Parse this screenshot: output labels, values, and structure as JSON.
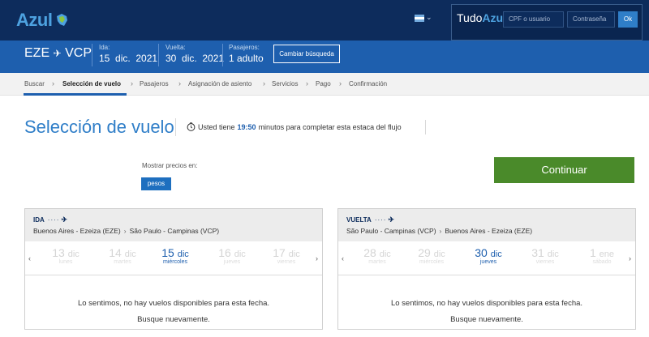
{
  "header": {
    "logo_text": "Azul",
    "tudo_prefix": "Tudo",
    "tudo_brand": "Azul",
    "cpf_placeholder": "CPF o usuario",
    "password_placeholder": "Contraseña",
    "ok_label": "Ok"
  },
  "search": {
    "route_from": "EZE",
    "route_to": "VCP",
    "ida_label": "Ida:",
    "ida_value": "15  dic.  2021",
    "vuelta_label": "Vuelta:",
    "vuelta_value": "30  dic.  2021",
    "pasajeros_label": "Pasajeros:",
    "pasajeros_value": "1 adulto",
    "change_label": "Cambiar búsqueda"
  },
  "steps": [
    "Buscar",
    "Selección de vuelo",
    "Pasajeros",
    "Asignación de asiento",
    "Servicios",
    "Pago",
    "Confirmación"
  ],
  "main": {
    "title": "Selección de vuelo",
    "timer_prefix": "Usted tiene",
    "timer_value": "19:50",
    "timer_suffix": "minutos para completar esta estaca del flujo",
    "show_prices_label": "Mostrar precios en:",
    "currency": "pesos",
    "continue_label": "Continuar"
  },
  "panels": [
    {
      "direction": "IDA",
      "origin": "Buenos Aires - Ezeiza (EZE)",
      "destination": "São Paulo - Campinas (VCP)",
      "days": [
        {
          "num": "13",
          "mon": "dic",
          "wd": "lunes"
        },
        {
          "num": "14",
          "mon": "dic",
          "wd": "martes"
        },
        {
          "num": "15",
          "mon": "dic",
          "wd": "miércoles"
        },
        {
          "num": "16",
          "mon": "dic",
          "wd": "jueves"
        },
        {
          "num": "17",
          "mon": "dic",
          "wd": "viernes"
        }
      ],
      "message_1": "Lo sentimos, no hay vuelos disponibles para esta fecha.",
      "message_2": "Busque nuevamente."
    },
    {
      "direction": "VUELTA",
      "origin": "São Paulo - Campinas (VCP)",
      "destination": "Buenos Aires - Ezeiza (EZE)",
      "days": [
        {
          "num": "28",
          "mon": "dic",
          "wd": "martes"
        },
        {
          "num": "29",
          "mon": "dic",
          "wd": "miércoles"
        },
        {
          "num": "30",
          "mon": "dic",
          "wd": "jueves"
        },
        {
          "num": "31",
          "mon": "dic",
          "wd": "viernes"
        },
        {
          "num": "1",
          "mon": "ene",
          "wd": "sábado"
        }
      ],
      "message_1": "Lo sentimos, no hay vuelos disponibles para esta fecha.",
      "message_2": "Busque nuevamente."
    }
  ]
}
